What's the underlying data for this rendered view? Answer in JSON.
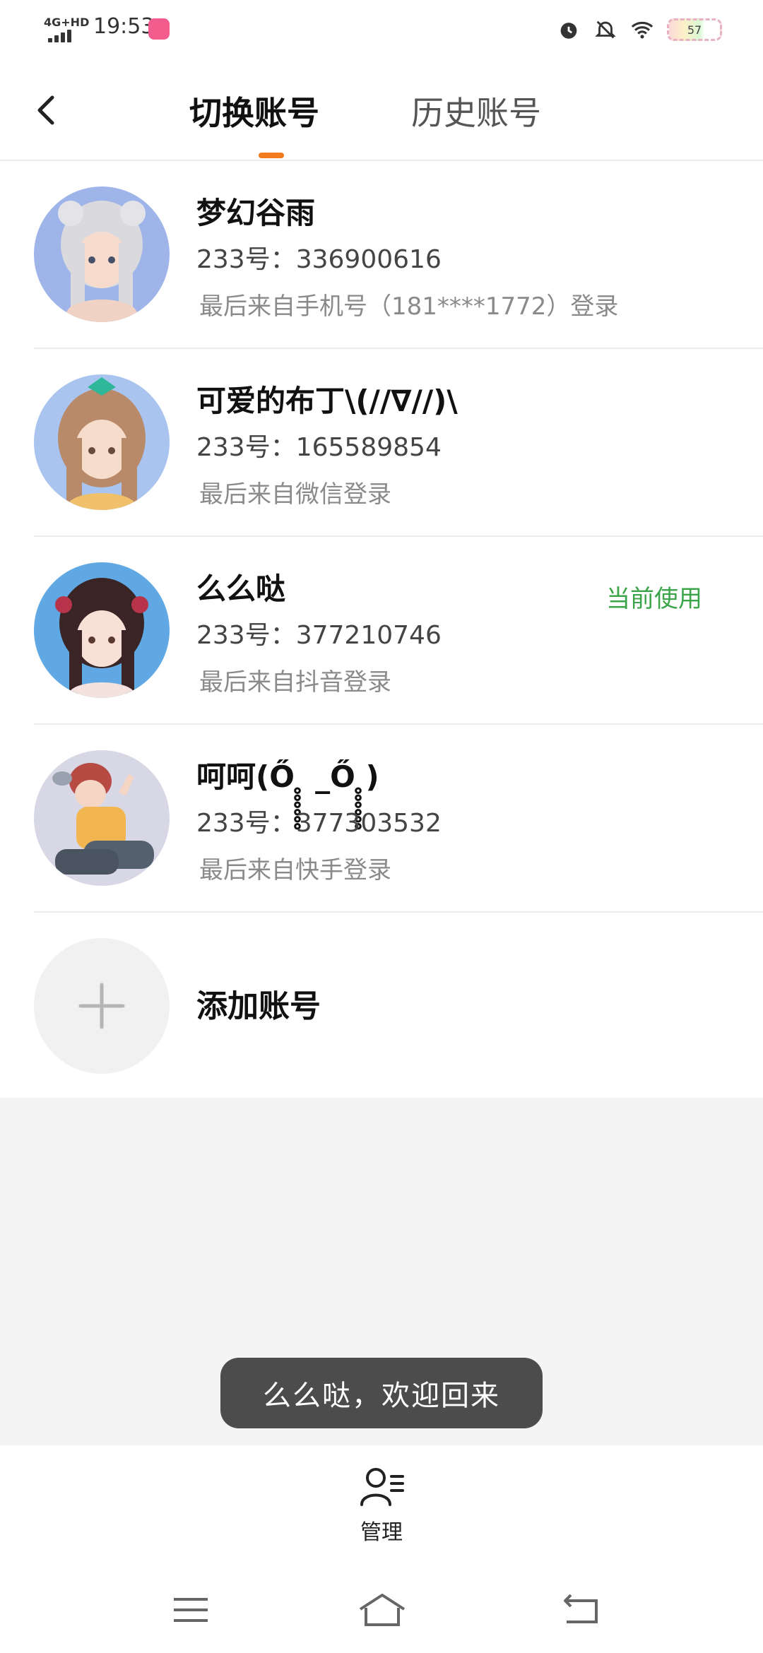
{
  "status_bar": {
    "network": "4G+HD",
    "time": "19:53",
    "battery": "57"
  },
  "header": {
    "back_icon": "chevron-left-icon",
    "tabs": [
      {
        "label": "切换账号",
        "active": true
      },
      {
        "label": "历史账号",
        "active": false
      }
    ],
    "accent_color": "#f37b1d"
  },
  "accounts": [
    {
      "name": "梦幻谷雨",
      "id_text": "233号：336900616",
      "source": "最后来自手机号（181****1772）登录",
      "current": ""
    },
    {
      "name": "可爱的布丁\\(//∇//)\\",
      "id_text": "233号：165589854",
      "source": "最后来自微信登录",
      "current": ""
    },
    {
      "name": "么么哒",
      "id_text": "233号：377210746",
      "source": "最后来自抖音登录",
      "current": "当前使用"
    },
    {
      "name": "呵呵(Ő ̥̥̥̥̥̥ _Ő ̥̥̥̥̥̥)",
      "id_text": "233号：377303532",
      "source": "最后来自快手登录",
      "current": ""
    }
  ],
  "add_account": {
    "icon": "plus-icon",
    "label": "添加账号"
  },
  "toast": {
    "text": "么么哒，欢迎回来"
  },
  "bottom_bar": {
    "icon": "manage-user-icon",
    "label": "管理"
  },
  "system_nav": {
    "menu_icon": "menu-icon",
    "home_icon": "home-icon",
    "back_icon": "back-icon"
  },
  "colors": {
    "current_label": "#3ca54a",
    "toast_bg": "#4c4c4c"
  }
}
